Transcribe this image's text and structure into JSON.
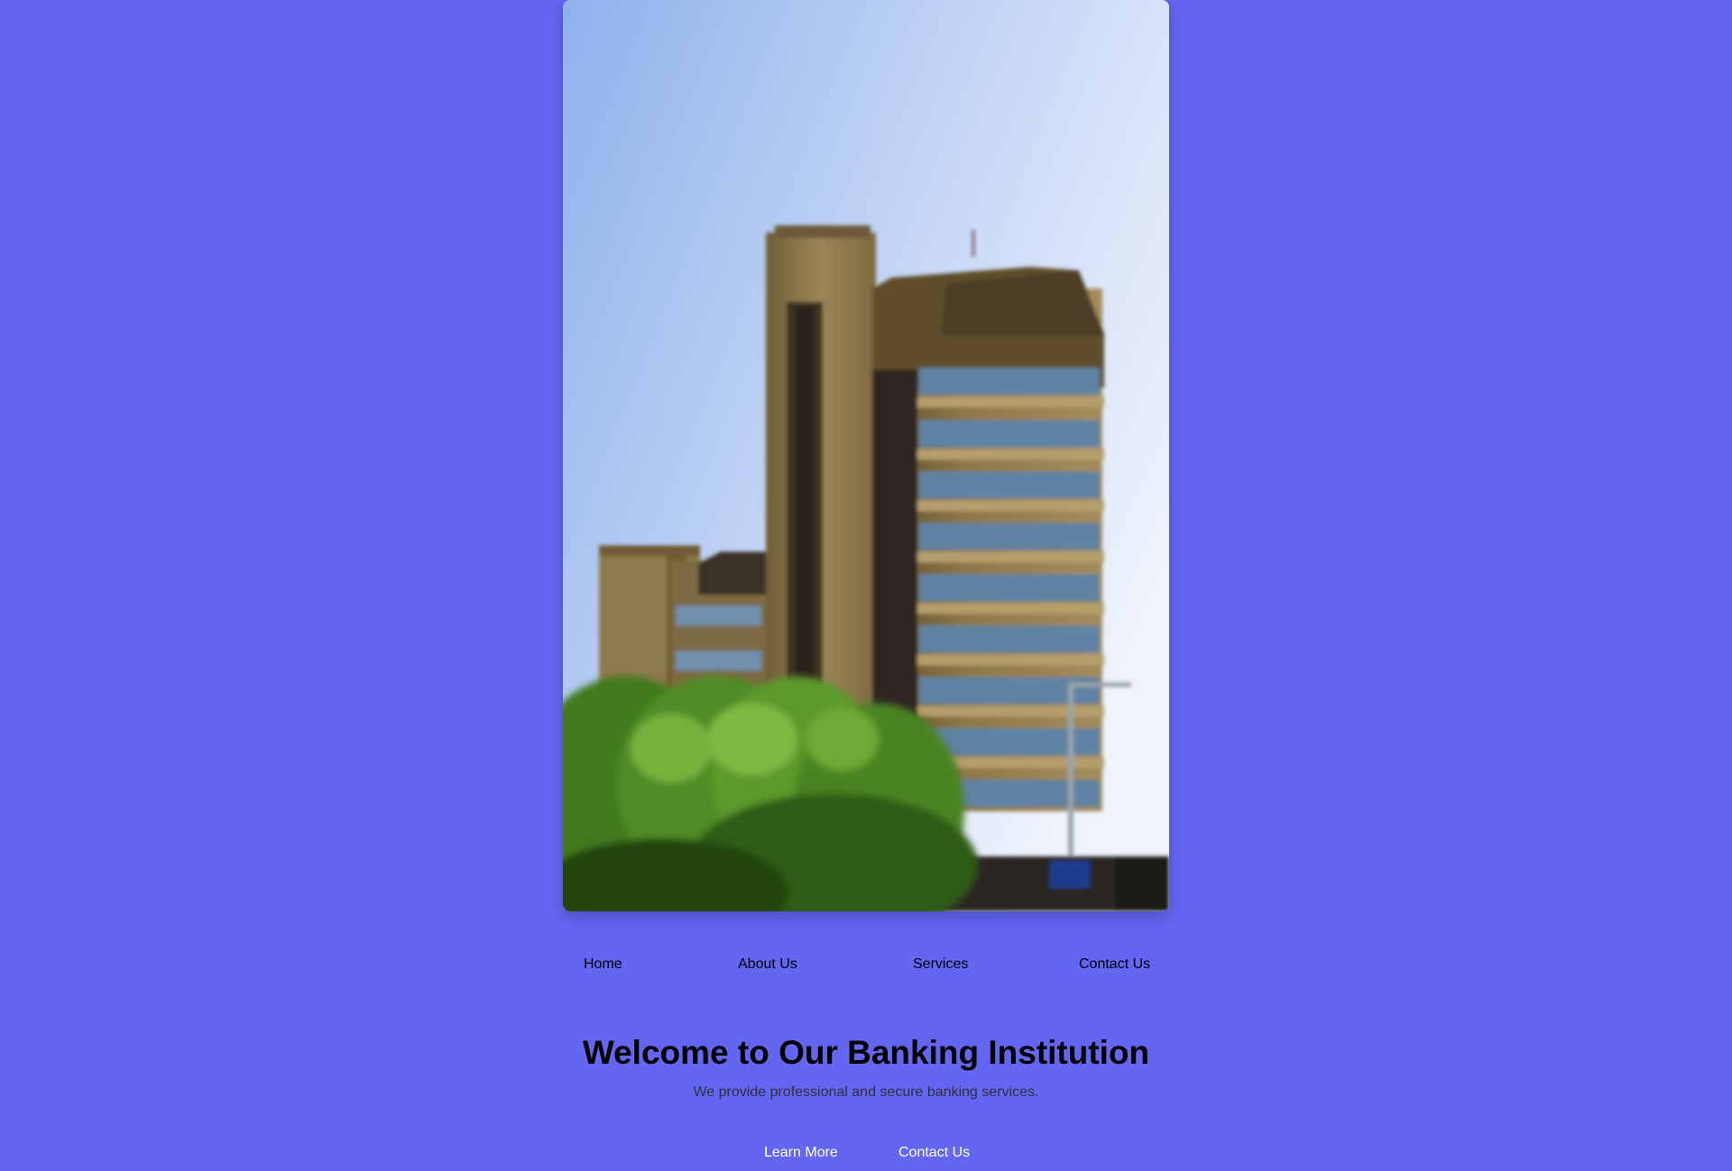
{
  "hero": {
    "image_alt": "Tall brown brick office building with rows of blue windows behind green trees",
    "colors": {
      "sky_top": "#9dbcf0",
      "sky_bottom": "#e4ecfb",
      "building": "#8f7a4c",
      "windows": "#5a7f9a",
      "trees": "#4f8a25"
    }
  },
  "nav": {
    "items": [
      {
        "label": "Home"
      },
      {
        "label": "About Us"
      },
      {
        "label": "Services"
      },
      {
        "label": "Contact Us"
      }
    ]
  },
  "welcome": {
    "title": "Welcome to Our Banking Institution",
    "subtitle": "We provide professional and secure banking services."
  },
  "cta": {
    "learn_more": "Learn More",
    "contact_us": "Contact Us"
  },
  "colors": {
    "page_background": "#6366f1",
    "cta_text": "#ffffff"
  }
}
